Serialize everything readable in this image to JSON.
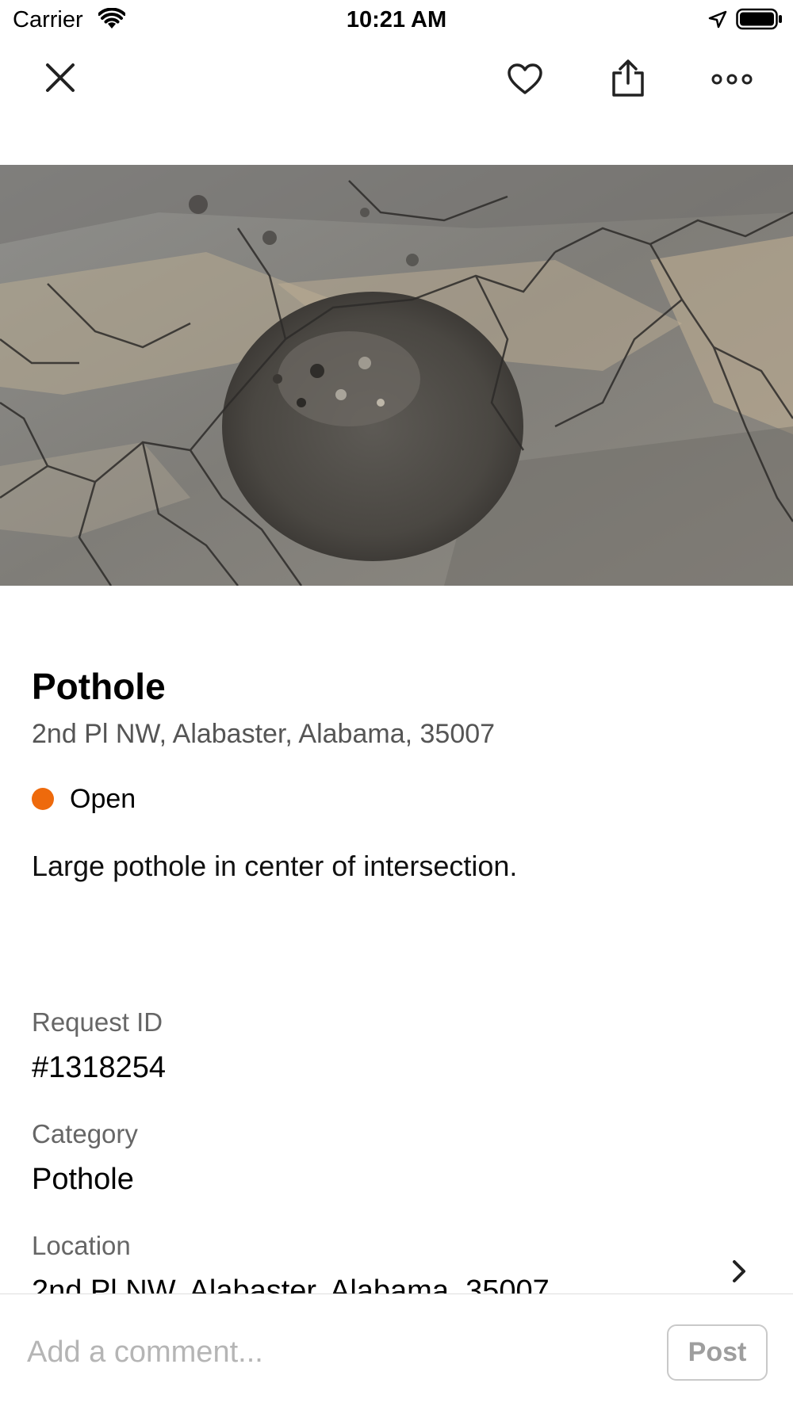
{
  "status_bar": {
    "carrier": "Carrier",
    "time": "10:21 AM",
    "icons": [
      "wifi-icon",
      "location-arrow-icon",
      "battery-icon"
    ]
  },
  "nav": {
    "icons": [
      "close-icon",
      "heart-icon",
      "share-icon",
      "more-icon"
    ]
  },
  "photo": {
    "subject": "pothole-photo"
  },
  "report": {
    "title": "Pothole",
    "address": "2nd Pl NW, Alabaster, Alabama, 35007",
    "status": "Open",
    "status_color": "#ee6a0c",
    "description": "Large pothole in center of intersection."
  },
  "fields": {
    "request_id": {
      "label": "Request ID",
      "value": "#1318254"
    },
    "category": {
      "label": "Category",
      "value": "Pothole"
    },
    "location": {
      "label": "Location",
      "value": "2nd Pl NW, Alabaster, Alabama, 35007"
    }
  },
  "comment": {
    "placeholder": "Add a comment...",
    "post_label": "Post"
  }
}
